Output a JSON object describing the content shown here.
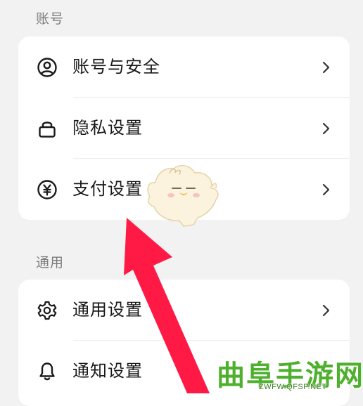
{
  "sections": [
    {
      "title": "账号",
      "items": [
        {
          "label": "账号与安全",
          "icon": "user-circle-icon"
        },
        {
          "label": "隐私设置",
          "icon": "lock-icon"
        },
        {
          "label": "支付设置",
          "icon": "yen-icon"
        }
      ]
    },
    {
      "title": "通用",
      "items": [
        {
          "label": "通用设置",
          "icon": "gear-icon"
        },
        {
          "label": "通知设置",
          "icon": "bell-icon"
        }
      ]
    }
  ],
  "overlay": {
    "arrow_color": "#ff1a45",
    "mascot": "chick-mascot-sticker"
  },
  "watermark": {
    "name": "曲阜手游网",
    "domain": "ZWFW.QFSP.NET",
    "color": "#4fb02e"
  }
}
